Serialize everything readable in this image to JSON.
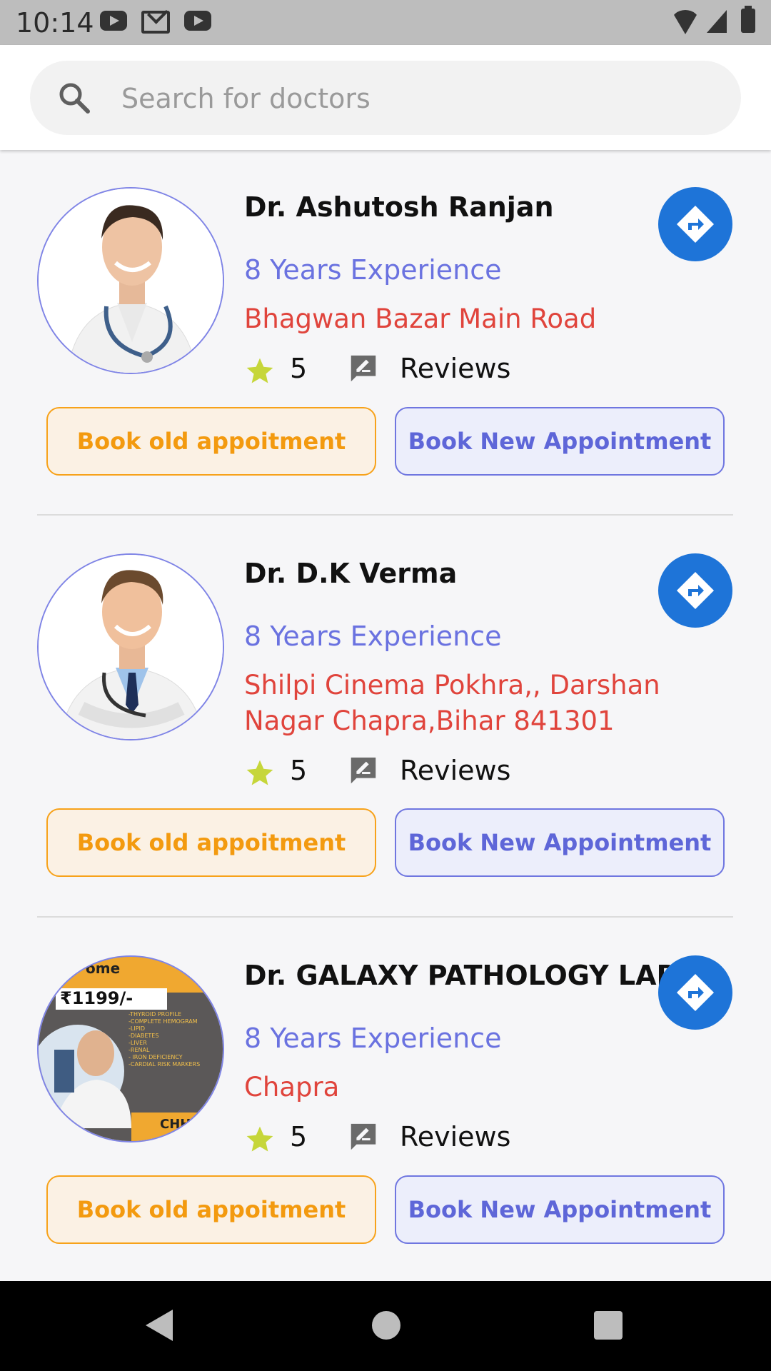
{
  "status_bar": {
    "time": "10:14",
    "icons": [
      "youtube-icon",
      "gmail-icon",
      "youtube-icon",
      "wifi-icon",
      "signal-icon",
      "battery-icon"
    ]
  },
  "search": {
    "placeholder": "Search for doctors",
    "value": "",
    "icon": "search-icon"
  },
  "doctors": [
    {
      "name": "Dr. Ashutosh Ranjan",
      "experience": "8 Years Experience",
      "address": "Bhagwan Bazar Main Road",
      "rating": "5",
      "reviews_label": "Reviews",
      "old_button": "Book old appoitment",
      "new_button": "Book New Appointment"
    },
    {
      "name": "Dr. D.K Verma",
      "experience": "8 Years Experience",
      "address": "Shilpi Cinema Pokhra,, Darshan Nagar Chapra,Bihar 841301",
      "rating": "5",
      "reviews_label": "Reviews",
      "old_button": "Book old appoitment",
      "new_button": "Book New Appointment"
    },
    {
      "name": "Dr. GALAXY PATHOLOGY LAB",
      "experience": "8 Years Experience",
      "address": "Chapra",
      "rating": "5",
      "reviews_label": "Reviews",
      "old_button": "Book old appoitment",
      "new_button": "Book New Appointment",
      "poster": {
        "top_text": "ome",
        "price": "₹1199/-",
        "tests": [
          "-THYROID PROFILE",
          "-COMPLETE HEMOGRAM",
          "-LIPID",
          "-DIABETES",
          "-LIVER",
          "-RENAL",
          "- IRON DEFICIENCY",
          "-CARDIAL RISK MARKERS"
        ],
        "bottom_text": "CHHA"
      }
    }
  ],
  "colors": {
    "accent_blue": "#1e74d8",
    "experience": "#6a72e0",
    "address": "#e0443c",
    "star": "#c6d63a",
    "old_button": "#f39a0f",
    "new_button": "#5e66d8"
  },
  "nav": {
    "back": "back-icon",
    "home": "home-icon",
    "recents": "recents-icon"
  }
}
